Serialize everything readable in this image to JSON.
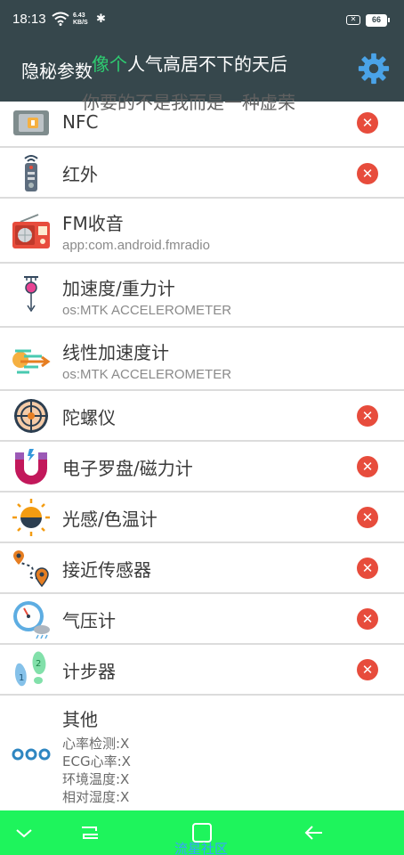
{
  "status": {
    "time": "18:13",
    "speed_top": "6.43",
    "speed_bottom": "KB/S",
    "bluetooth": "✱",
    "sim": "✕",
    "battery": "66"
  },
  "appbar": {
    "title": "隐秘参数",
    "settings_icon": "gear-icon"
  },
  "lyrics": {
    "line1_highlight": "像个",
    "line1_rest": "人气高居不下的天后",
    "line2": "你要的不是我而是一种虚荣"
  },
  "colors": {
    "header": "#36474c",
    "navbar": "#1ef45c",
    "unsupported": "#e74c3c",
    "lyric_highlight": "#2ecc71"
  },
  "sensors": [
    {
      "name": "NFC",
      "sub": "",
      "icon": "nfc-icon",
      "supported": false
    },
    {
      "name": "红外",
      "sub": "",
      "icon": "remote-control-icon",
      "supported": false
    },
    {
      "name": "FM收音",
      "sub": "app:com.android.fmradio",
      "icon": "radio-icon",
      "supported": true
    },
    {
      "name": "加速度/重力计",
      "sub": "os:MTK ACCELEROMETER",
      "icon": "gravity-pendulum-icon",
      "supported": true
    },
    {
      "name": "线性加速度计",
      "sub": "os:MTK ACCELEROMETER",
      "icon": "speed-lines-icon",
      "supported": true
    },
    {
      "name": "陀螺仪",
      "sub": "",
      "icon": "gyroscope-icon",
      "supported": false
    },
    {
      "name": "电子罗盘/磁力计",
      "sub": "",
      "icon": "magnet-icon",
      "supported": false
    },
    {
      "name": "光感/色温计",
      "sub": "",
      "icon": "light-sensor-icon",
      "supported": false
    },
    {
      "name": "接近传感器",
      "sub": "",
      "icon": "proximity-route-icon",
      "supported": false
    },
    {
      "name": "气压计",
      "sub": "",
      "icon": "barometer-icon",
      "supported": false
    },
    {
      "name": "计步器",
      "sub": "",
      "icon": "footsteps-icon",
      "supported": false
    }
  ],
  "others": {
    "name": "其他",
    "icon": "more-dots-icon",
    "lines": [
      "心率检测:X",
      "ECG心率:X",
      "环境温度:X",
      "相对湿度:X"
    ]
  },
  "unsupported_mark": "✕",
  "navbar": {
    "buttons": [
      "chevron-down-icon",
      "menu-icon",
      "home-icon",
      "back-icon"
    ],
    "watermark": "流星社区"
  }
}
